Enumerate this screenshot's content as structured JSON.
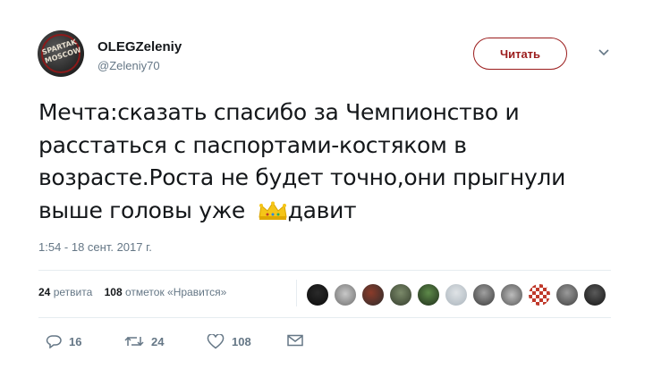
{
  "author": {
    "display_name": "OLEGZeleniy",
    "handle": "@Zeleniy70",
    "avatar_text": "SPARTAK MOSCOW"
  },
  "follow_button": {
    "label": "Читать"
  },
  "tweet": {
    "text": "Мечта:сказать спасибо за Чемпионство и расстаться с паспортами-костяком в возрасте.Роста не будет точно,они прыгнули выше головы уже",
    "text_after_emoji": "давит",
    "emoji": "crown-emoji"
  },
  "timestamp": "1:54 - 18 сент. 2017 г.",
  "stats": {
    "retweets_count": "24",
    "retweets_label": "ретвита",
    "likes_count": "108",
    "likes_label": "отметок «Нравится»"
  },
  "liker_avatars": [
    "dark-bird",
    "gray-face",
    "photo-red",
    "landscape",
    "green-figure",
    "default-gray",
    "person-photo",
    "car-photo",
    "red-checkered",
    "gray-photo",
    "dark-photo"
  ],
  "actions": {
    "reply_count": "16",
    "retweet_count": "24",
    "like_count": "108"
  },
  "colors": {
    "accent": "#9b1c1c",
    "muted": "#657786",
    "text": "#14171a",
    "divider": "#e6ecf0"
  }
}
